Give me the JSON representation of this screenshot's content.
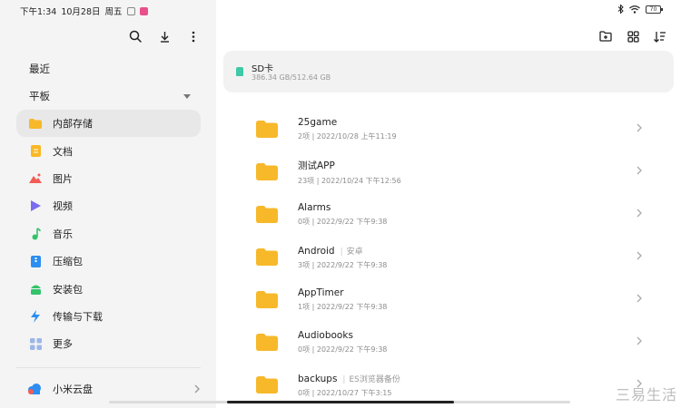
{
  "status": {
    "time": "下午1:34",
    "date": "10月28日",
    "weekday": "周五",
    "battery": "70"
  },
  "sidebar": {
    "recent": "最近",
    "tablet": "平板",
    "items": [
      {
        "label": "内部存储",
        "icon": "folder-icon",
        "color": "#f4b400",
        "active": true
      },
      {
        "label": "文档",
        "icon": "document-icon",
        "color": "#f9b824"
      },
      {
        "label": "图片",
        "icon": "image-icon",
        "color": "#f25c54"
      },
      {
        "label": "视频",
        "icon": "video-icon",
        "color": "#6c63ff"
      },
      {
        "label": "音乐",
        "icon": "music-icon",
        "color": "#34c26b"
      },
      {
        "label": "压缩包",
        "icon": "archive-icon",
        "color": "#2b8ef0"
      },
      {
        "label": "安装包",
        "icon": "android-icon",
        "color": "#34c26b"
      },
      {
        "label": "传输与下载",
        "icon": "transfer-icon",
        "color": "#2b8ef0"
      },
      {
        "label": "更多",
        "icon": "more-grid-icon",
        "color": "#9db6e8"
      }
    ],
    "cloud": "小米云盘"
  },
  "sd_card": {
    "title": "SD卡",
    "usage": "386.34 GB/512.64 GB"
  },
  "files": [
    {
      "name": "25game",
      "alias": "",
      "meta": "2项 | 2022/10/28 上午11:19"
    },
    {
      "name": "测试APP",
      "alias": "",
      "meta": "23项 | 2022/10/24 下午12:56"
    },
    {
      "name": "Alarms",
      "alias": "",
      "meta": "0项 | 2022/9/22 下午9:38"
    },
    {
      "name": "Android",
      "alias": "安卓",
      "meta": "3项 | 2022/9/22 下午9:38"
    },
    {
      "name": "AppTimer",
      "alias": "",
      "meta": "1项 | 2022/9/22 下午9:38"
    },
    {
      "name": "Audiobooks",
      "alias": "",
      "meta": "0项 | 2022/9/22 下午9:38"
    },
    {
      "name": "backups",
      "alias": "ES浏览器备份",
      "meta": "0项 | 2022/10/27 下午3:15"
    }
  ],
  "watermark": "三易生活",
  "colors": {
    "folder": "#f7b82a",
    "sidebar_bg": "#f4f4f4",
    "active_bg": "#e8e8e8",
    "sd_accent": "#3ec9a7"
  }
}
